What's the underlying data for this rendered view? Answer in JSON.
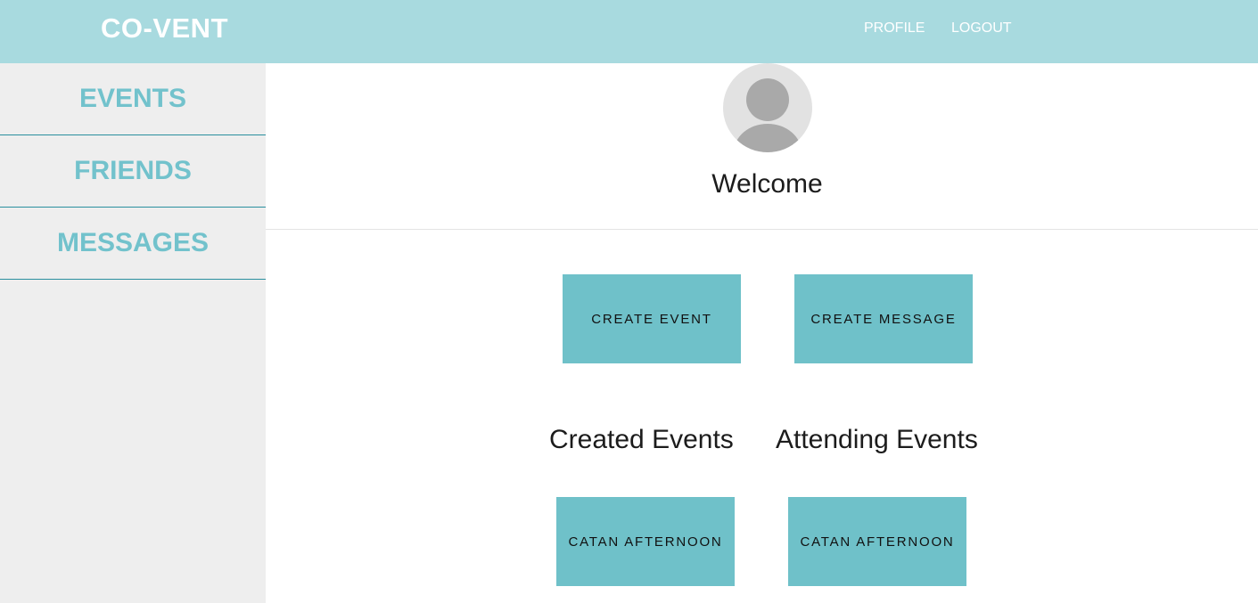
{
  "header": {
    "brand": "CO-VENT",
    "nav": {
      "profile": "PROFILE",
      "logout": "LOGOUT"
    }
  },
  "sidebar": {
    "items": [
      {
        "label": "EVENTS"
      },
      {
        "label": "FRIENDS"
      },
      {
        "label": "MESSAGES"
      }
    ]
  },
  "main": {
    "avatar_icon": "user-avatar-icon",
    "welcome": "Welcome",
    "actions": {
      "create_event": "CREATE EVENT",
      "create_message": "CREATE MESSAGE"
    },
    "created_events": {
      "heading": "Created Events",
      "items": [
        {
          "title": "CATAN AFTERNOON"
        }
      ]
    },
    "attending_events": {
      "heading": "Attending Events",
      "items": [
        {
          "title": "CATAN AFTERNOON"
        }
      ]
    }
  },
  "colors": {
    "header_bg": "#a8dadf",
    "sidebar_bg": "#eeeeee",
    "accent": "#6fc1c9",
    "sidebar_text": "#72c2cc",
    "sidebar_border": "#2a8f9e"
  }
}
